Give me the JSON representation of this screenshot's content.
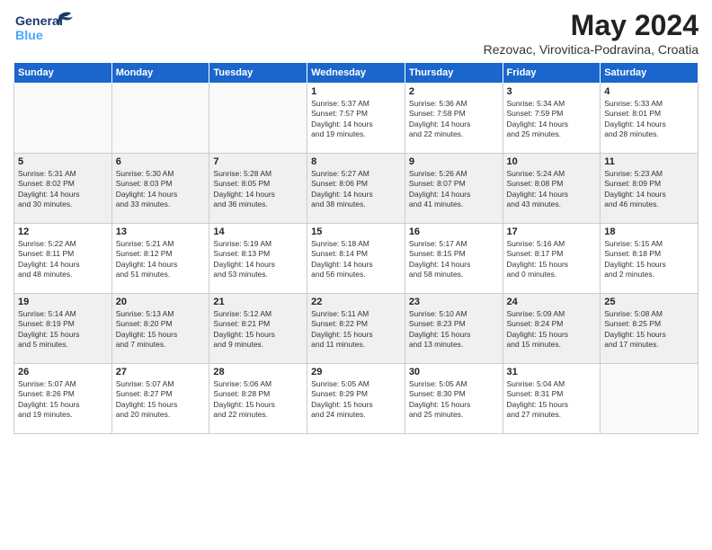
{
  "header": {
    "logo_line1": "General",
    "logo_line2": "Blue",
    "month": "May 2024",
    "location": "Rezovac, Virovitica-Podravina, Croatia"
  },
  "weekdays": [
    "Sunday",
    "Monday",
    "Tuesday",
    "Wednesday",
    "Thursday",
    "Friday",
    "Saturday"
  ],
  "weeks": [
    [
      {
        "day": "",
        "text": ""
      },
      {
        "day": "",
        "text": ""
      },
      {
        "day": "",
        "text": ""
      },
      {
        "day": "1",
        "text": "Sunrise: 5:37 AM\nSunset: 7:57 PM\nDaylight: 14 hours\nand 19 minutes."
      },
      {
        "day": "2",
        "text": "Sunrise: 5:36 AM\nSunset: 7:58 PM\nDaylight: 14 hours\nand 22 minutes."
      },
      {
        "day": "3",
        "text": "Sunrise: 5:34 AM\nSunset: 7:59 PM\nDaylight: 14 hours\nand 25 minutes."
      },
      {
        "day": "4",
        "text": "Sunrise: 5:33 AM\nSunset: 8:01 PM\nDaylight: 14 hours\nand 28 minutes."
      }
    ],
    [
      {
        "day": "5",
        "text": "Sunrise: 5:31 AM\nSunset: 8:02 PM\nDaylight: 14 hours\nand 30 minutes."
      },
      {
        "day": "6",
        "text": "Sunrise: 5:30 AM\nSunset: 8:03 PM\nDaylight: 14 hours\nand 33 minutes."
      },
      {
        "day": "7",
        "text": "Sunrise: 5:28 AM\nSunset: 8:05 PM\nDaylight: 14 hours\nand 36 minutes."
      },
      {
        "day": "8",
        "text": "Sunrise: 5:27 AM\nSunset: 8:06 PM\nDaylight: 14 hours\nand 38 minutes."
      },
      {
        "day": "9",
        "text": "Sunrise: 5:26 AM\nSunset: 8:07 PM\nDaylight: 14 hours\nand 41 minutes."
      },
      {
        "day": "10",
        "text": "Sunrise: 5:24 AM\nSunset: 8:08 PM\nDaylight: 14 hours\nand 43 minutes."
      },
      {
        "day": "11",
        "text": "Sunrise: 5:23 AM\nSunset: 8:09 PM\nDaylight: 14 hours\nand 46 minutes."
      }
    ],
    [
      {
        "day": "12",
        "text": "Sunrise: 5:22 AM\nSunset: 8:11 PM\nDaylight: 14 hours\nand 48 minutes."
      },
      {
        "day": "13",
        "text": "Sunrise: 5:21 AM\nSunset: 8:12 PM\nDaylight: 14 hours\nand 51 minutes."
      },
      {
        "day": "14",
        "text": "Sunrise: 5:19 AM\nSunset: 8:13 PM\nDaylight: 14 hours\nand 53 minutes."
      },
      {
        "day": "15",
        "text": "Sunrise: 5:18 AM\nSunset: 8:14 PM\nDaylight: 14 hours\nand 56 minutes."
      },
      {
        "day": "16",
        "text": "Sunrise: 5:17 AM\nSunset: 8:15 PM\nDaylight: 14 hours\nand 58 minutes."
      },
      {
        "day": "17",
        "text": "Sunrise: 5:16 AM\nSunset: 8:17 PM\nDaylight: 15 hours\nand 0 minutes."
      },
      {
        "day": "18",
        "text": "Sunrise: 5:15 AM\nSunset: 8:18 PM\nDaylight: 15 hours\nand 2 minutes."
      }
    ],
    [
      {
        "day": "19",
        "text": "Sunrise: 5:14 AM\nSunset: 8:19 PM\nDaylight: 15 hours\nand 5 minutes."
      },
      {
        "day": "20",
        "text": "Sunrise: 5:13 AM\nSunset: 8:20 PM\nDaylight: 15 hours\nand 7 minutes."
      },
      {
        "day": "21",
        "text": "Sunrise: 5:12 AM\nSunset: 8:21 PM\nDaylight: 15 hours\nand 9 minutes."
      },
      {
        "day": "22",
        "text": "Sunrise: 5:11 AM\nSunset: 8:22 PM\nDaylight: 15 hours\nand 11 minutes."
      },
      {
        "day": "23",
        "text": "Sunrise: 5:10 AM\nSunset: 8:23 PM\nDaylight: 15 hours\nand 13 minutes."
      },
      {
        "day": "24",
        "text": "Sunrise: 5:09 AM\nSunset: 8:24 PM\nDaylight: 15 hours\nand 15 minutes."
      },
      {
        "day": "25",
        "text": "Sunrise: 5:08 AM\nSunset: 8:25 PM\nDaylight: 15 hours\nand 17 minutes."
      }
    ],
    [
      {
        "day": "26",
        "text": "Sunrise: 5:07 AM\nSunset: 8:26 PM\nDaylight: 15 hours\nand 19 minutes."
      },
      {
        "day": "27",
        "text": "Sunrise: 5:07 AM\nSunset: 8:27 PM\nDaylight: 15 hours\nand 20 minutes."
      },
      {
        "day": "28",
        "text": "Sunrise: 5:06 AM\nSunset: 8:28 PM\nDaylight: 15 hours\nand 22 minutes."
      },
      {
        "day": "29",
        "text": "Sunrise: 5:05 AM\nSunset: 8:29 PM\nDaylight: 15 hours\nand 24 minutes."
      },
      {
        "day": "30",
        "text": "Sunrise: 5:05 AM\nSunset: 8:30 PM\nDaylight: 15 hours\nand 25 minutes."
      },
      {
        "day": "31",
        "text": "Sunrise: 5:04 AM\nSunset: 8:31 PM\nDaylight: 15 hours\nand 27 minutes."
      },
      {
        "day": "",
        "text": ""
      }
    ]
  ]
}
